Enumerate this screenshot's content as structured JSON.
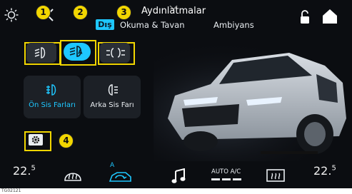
{
  "header": {
    "title": "Aydınlatmalar",
    "tabs": [
      {
        "label": "Dış",
        "active": true
      },
      {
        "label": "Okuma & Tavan",
        "active": false
      },
      {
        "label": "Ambiyans",
        "active": false
      }
    ]
  },
  "top_icons": {
    "left": [
      "sun-icon",
      "back-chevron-icon"
    ],
    "right": [
      "unlock-icon",
      "home-icon"
    ]
  },
  "light_buttons": [
    {
      "icon": "low-beam-icon",
      "active": false
    },
    {
      "icon": "auto-headlight-icon",
      "active": true
    },
    {
      "icon": "parking-light-icon",
      "active": false
    }
  ],
  "fog_buttons": [
    {
      "label": "Ön Sis Farları",
      "icon": "front-fog-icon",
      "active": true
    },
    {
      "label": "Arka Sis Farı",
      "icon": "rear-fog-icon",
      "active": false
    }
  ],
  "callouts": [
    "1",
    "2",
    "3",
    "4"
  ],
  "settings": {
    "icon": "gear-icon"
  },
  "bottom_bar": {
    "left_temp": "22.",
    "left_temp_decimal": "5",
    "right_temp": "22.",
    "right_temp_decimal": "5",
    "ac_label": "AUTO A/C",
    "recirc_letter": "A",
    "icons": [
      "front-defrost-icon",
      "car-recirculation-icon",
      "music-note-icon",
      "rear-defrost-icon"
    ]
  },
  "caption": "TG02121",
  "colors": {
    "background": "#0b0d11",
    "accent": "#1ec7ff",
    "callout_yellow": "#f2d600",
    "button_bg": "#2a2f36"
  }
}
